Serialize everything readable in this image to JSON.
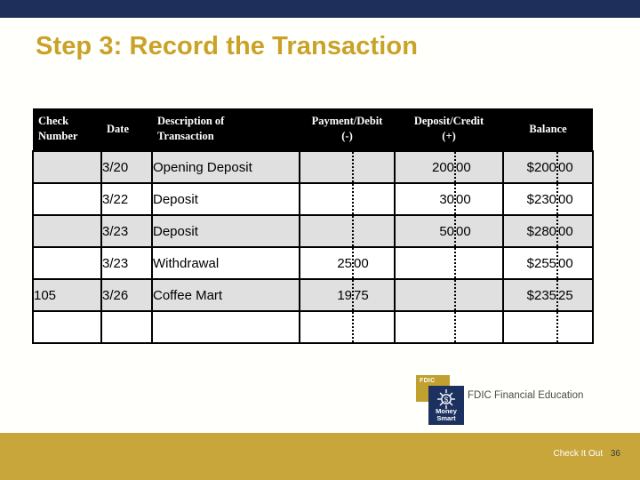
{
  "theme": {
    "band_navy": "#1d2f5a",
    "band_gold": "#c9a63c",
    "title_gold": "#c9a227",
    "header_bg": "#000000",
    "row_shade": "#e0e0e0"
  },
  "title": "Step 3: Record the Transaction",
  "table": {
    "headers": {
      "check": "Check",
      "check_sub": "Number",
      "date": "Date",
      "description": "Description of",
      "description_sub": "Transaction",
      "payment": "Payment/Debit",
      "payment_sub": "(-)",
      "deposit": "Deposit/Credit",
      "deposit_sub": "(+)",
      "balance": "Balance",
      "balance_sub": ""
    },
    "rows": [
      {
        "check": "",
        "date": "3/20",
        "description": "Opening Deposit",
        "payment_dollars": "",
        "payment_cents": "",
        "deposit_dollars": "200",
        "deposit_cents": "00",
        "balance_dollars": "$200",
        "balance_cents": "00",
        "shaded": true
      },
      {
        "check": "",
        "date": "3/22",
        "description": "Deposit",
        "payment_dollars": "",
        "payment_cents": "",
        "deposit_dollars": "30",
        "deposit_cents": "00",
        "balance_dollars": "$230",
        "balance_cents": "00",
        "shaded": false
      },
      {
        "check": "",
        "date": "3/23",
        "description": "Deposit",
        "payment_dollars": "",
        "payment_cents": "",
        "deposit_dollars": "50",
        "deposit_cents": "00",
        "balance_dollars": "$280",
        "balance_cents": "00",
        "shaded": true
      },
      {
        "check": "",
        "date": "3/23",
        "description": "Withdrawal",
        "payment_dollars": "25",
        "payment_cents": "00",
        "deposit_dollars": "",
        "deposit_cents": "",
        "balance_dollars": "$255",
        "balance_cents": "00",
        "shaded": false
      },
      {
        "check": "105",
        "date": "3/26",
        "description": "Coffee Mart",
        "payment_dollars": "19",
        "payment_cents": "75",
        "deposit_dollars": "",
        "deposit_cents": "",
        "balance_dollars": "$235",
        "balance_cents": "25",
        "shaded": true
      },
      {
        "check": "",
        "date": "",
        "description": "",
        "payment_dollars": "",
        "payment_cents": "",
        "deposit_dollars": "",
        "deposit_cents": "",
        "balance_dollars": "",
        "balance_cents": "",
        "shaded": false
      }
    ]
  },
  "logo": {
    "fdic_tag": "FDIC",
    "money": "Money",
    "smart": "Smart",
    "caption": "FDIC Financial Education"
  },
  "footer": {
    "label": "Check It Out",
    "page": "36"
  }
}
